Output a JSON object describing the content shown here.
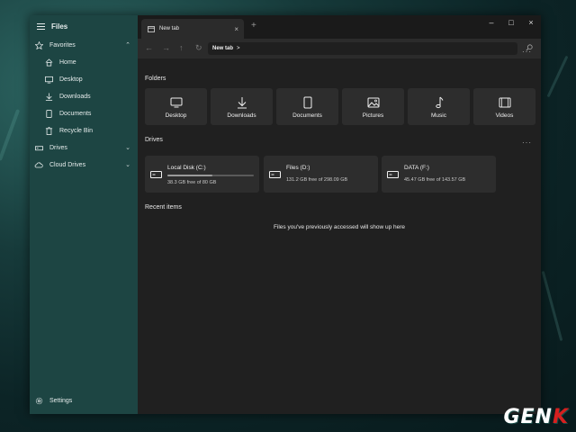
{
  "app": {
    "title": "Files"
  },
  "sidebar": {
    "items": [
      {
        "label": "Favorites",
        "icon": "star-icon",
        "section": true
      },
      {
        "label": "Home",
        "icon": "home-icon"
      },
      {
        "label": "Desktop",
        "icon": "desktop-icon"
      },
      {
        "label": "Downloads",
        "icon": "download-icon"
      },
      {
        "label": "Documents",
        "icon": "document-icon"
      },
      {
        "label": "Recycle Bin",
        "icon": "recycle-bin-icon"
      },
      {
        "label": "Drives",
        "icon": "drive-icon",
        "section": true
      },
      {
        "label": "Cloud Drives",
        "icon": "cloud-icon",
        "section": true
      }
    ],
    "settings_label": "Settings"
  },
  "tabs": [
    {
      "label": "New tab"
    }
  ],
  "address": {
    "crumb": "New tab",
    "separator": ">"
  },
  "folders": {
    "title": "Folders",
    "items": [
      {
        "label": "Desktop",
        "icon": "desktop-icon"
      },
      {
        "label": "Downloads",
        "icon": "download-icon"
      },
      {
        "label": "Documents",
        "icon": "document-icon"
      },
      {
        "label": "Pictures",
        "icon": "picture-icon"
      },
      {
        "label": "Music",
        "icon": "music-icon"
      },
      {
        "label": "Videos",
        "icon": "video-icon"
      }
    ]
  },
  "drives": {
    "title": "Drives",
    "items": [
      {
        "name": "Local Disk (C:)",
        "free": "38.3 GB free of 80 GB",
        "used_fraction": 0.52,
        "show_bar": true
      },
      {
        "name": "Files (D:)",
        "free": "131.2 GB free of 298.09 GB",
        "used_fraction": 0.56,
        "show_bar": false
      },
      {
        "name": "DATA (F:)",
        "free": "45.47 GB free of 143.57 GB",
        "used_fraction": 0.68,
        "show_bar": false
      }
    ]
  },
  "recent": {
    "title": "Recent items",
    "empty_message": "Files you've previously accessed will show up here"
  },
  "watermark": {
    "text_main": "GEN",
    "text_accent": "K"
  },
  "colors": {
    "sidebar_bg": "#1d4543",
    "main_bg": "#202020",
    "card_bg": "#2d2d2d",
    "logo_accent": "#d6201f"
  }
}
